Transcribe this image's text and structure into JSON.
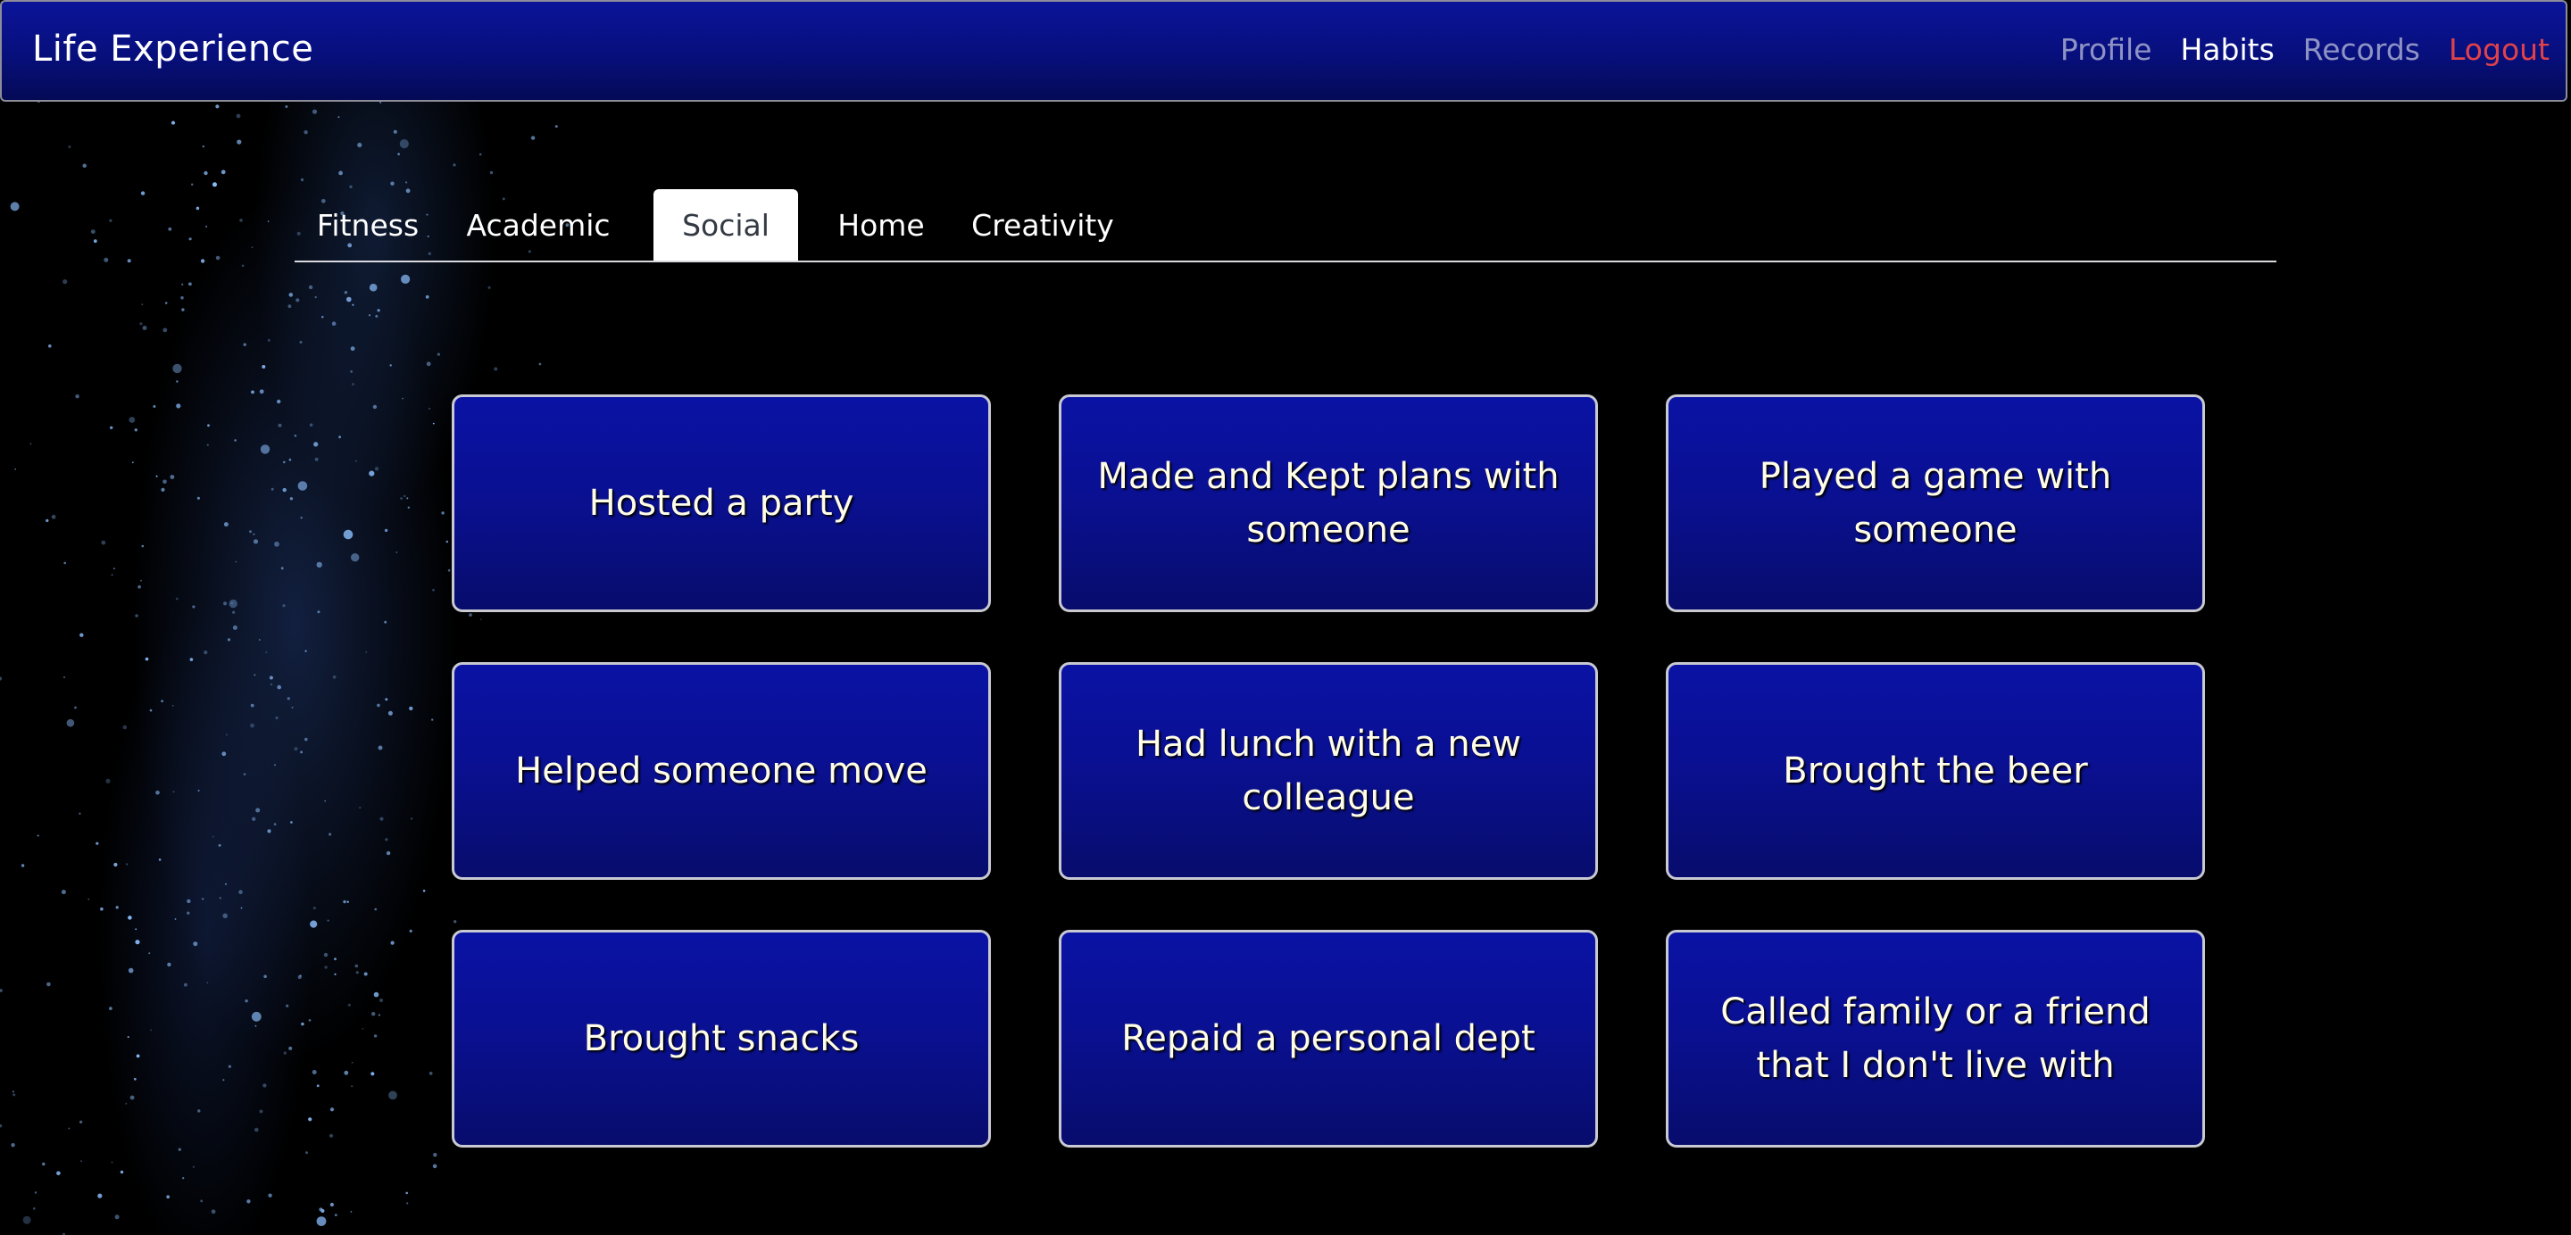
{
  "app": {
    "brand": "Life Experience"
  },
  "nav": {
    "profile": "Profile",
    "habits": "Habits",
    "records": "Records",
    "logout": "Logout"
  },
  "tabs": [
    {
      "label": "Fitness",
      "active": false
    },
    {
      "label": "Academic",
      "active": false
    },
    {
      "label": "Social",
      "active": true
    },
    {
      "label": "Home",
      "active": false
    },
    {
      "label": "Creativity",
      "active": false
    }
  ],
  "cards": [
    {
      "label": "Hosted a party"
    },
    {
      "label": "Made and Kept plans with someone"
    },
    {
      "label": "Played a game with someone"
    },
    {
      "label": "Helped someone move"
    },
    {
      "label": "Had lunch with a new colleague"
    },
    {
      "label": "Brought the beer"
    },
    {
      "label": "Brought snacks"
    },
    {
      "label": "Repaid a personal dept"
    },
    {
      "label": "Called family or a friend that I don't live with"
    }
  ],
  "colors": {
    "navbar": "#070f7c",
    "card": "#0a1092",
    "logout": "#e0424a",
    "card_text": "#fffde6"
  }
}
